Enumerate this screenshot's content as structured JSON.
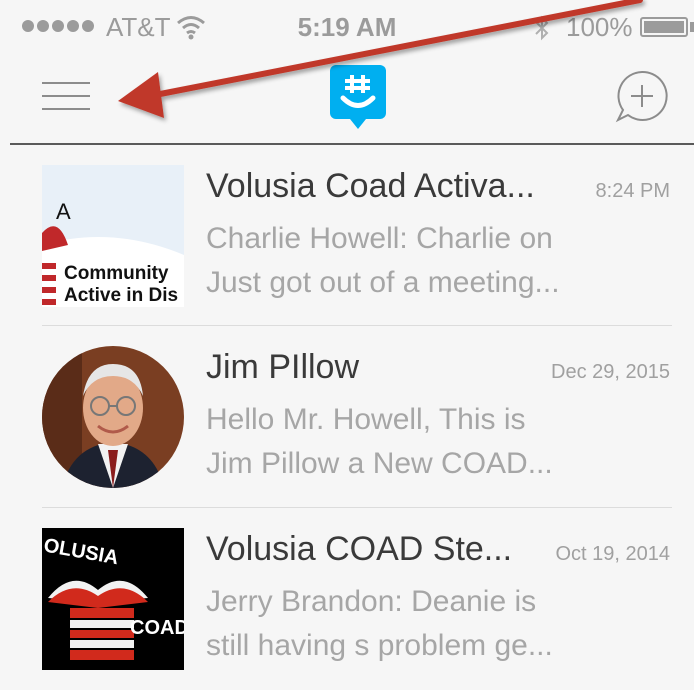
{
  "status_bar": {
    "carrier": "AT&T",
    "time": "5:19 AM",
    "battery_percent": "100%",
    "battery_level": 1.0,
    "icons": [
      "signal-dots-icon",
      "wifi-icon",
      "bluetooth-icon",
      "battery-icon"
    ]
  },
  "nav_bar": {
    "icons": [
      "hamburger-menu-icon",
      "groupme-logo-icon",
      "compose-message-icon"
    ]
  },
  "colors": {
    "brand": "#00aff0",
    "annotation_arrow": "#c0392b",
    "title_text": "#3a3a3a",
    "secondary_text": "#a6a6a6"
  },
  "conversations": [
    {
      "name": "Volusia Coad Activa...",
      "time": "8:24 PM",
      "preview": [
        "Charlie Howell: Charlie on",
        "Just got out of a meeting..."
      ],
      "avatar_text": [
        "A",
        "Community",
        "Active in Dis"
      ]
    },
    {
      "name": "Jim PIllow",
      "time": "Dec 29, 2015",
      "preview": [
        "Hello Mr. Howell, This is",
        "Jim Pillow a New COAD..."
      ]
    },
    {
      "name": "Volusia COAD Ste...",
      "time": "Oct 19, 2014",
      "preview": [
        "Jerry Brandon: Deanie is",
        "still having s problem ge..."
      ],
      "avatar_text": [
        "OLUSIA",
        "COAD"
      ]
    }
  ]
}
